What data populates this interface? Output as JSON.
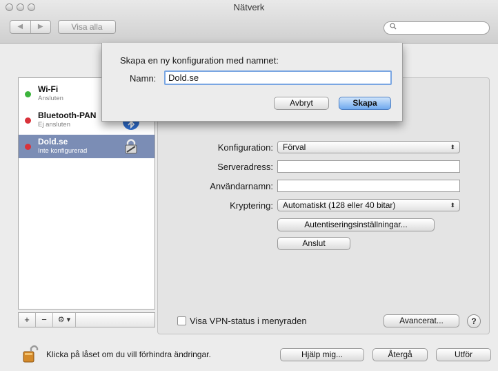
{
  "window": {
    "title": "Nätverk"
  },
  "toolbar": {
    "back": "◀",
    "forward": "▶",
    "show_all": "Visa alla",
    "search_placeholder": ""
  },
  "services": [
    {
      "name": "Wi-Fi",
      "status": "Ansluten",
      "dot_color": "#3cb43c"
    },
    {
      "name": "Bluetooth-PAN",
      "status": "Ej ansluten",
      "dot_color": "#d9323a"
    },
    {
      "name": "Dold.se",
      "status": "Inte konfigurerad",
      "dot_color": "#d9323a"
    }
  ],
  "sidebar_controls": {
    "add": "+",
    "remove": "−",
    "action": "⚙ ▾"
  },
  "form": {
    "konfiguration_label": "Konfiguration:",
    "konfiguration_value": "Förval",
    "server_label": "Serveradress:",
    "server_value": "",
    "user_label": "Användarnamn:",
    "user_value": "",
    "encryption_label": "Kryptering:",
    "encryption_value": "Automatiskt (128 eller 40 bitar)",
    "auth_button": "Autentiseringsinställningar...",
    "connect_button": "Anslut"
  },
  "panel_bottom": {
    "vpn_checkbox_label": "Visa VPN-status i menyraden",
    "vpn_checked": false,
    "advanced_button": "Avancerat...",
    "help": "?"
  },
  "footer": {
    "lock_text": "Klicka på låset om du vill förhindra ändringar.",
    "help_button": "Hjälp mig...",
    "revert_button": "Återgå",
    "apply_button": "Utför"
  },
  "sheet": {
    "prompt": "Skapa en ny konfiguration med namnet:",
    "name_label": "Namn:",
    "name_value": "Dold.se",
    "cancel_button": "Avbryt",
    "create_button": "Skapa"
  },
  "colors": {
    "selection": "#7b8db5",
    "default_button": "#6fa9ef",
    "connected": "#3cb43c",
    "disconnected": "#d9323a"
  }
}
